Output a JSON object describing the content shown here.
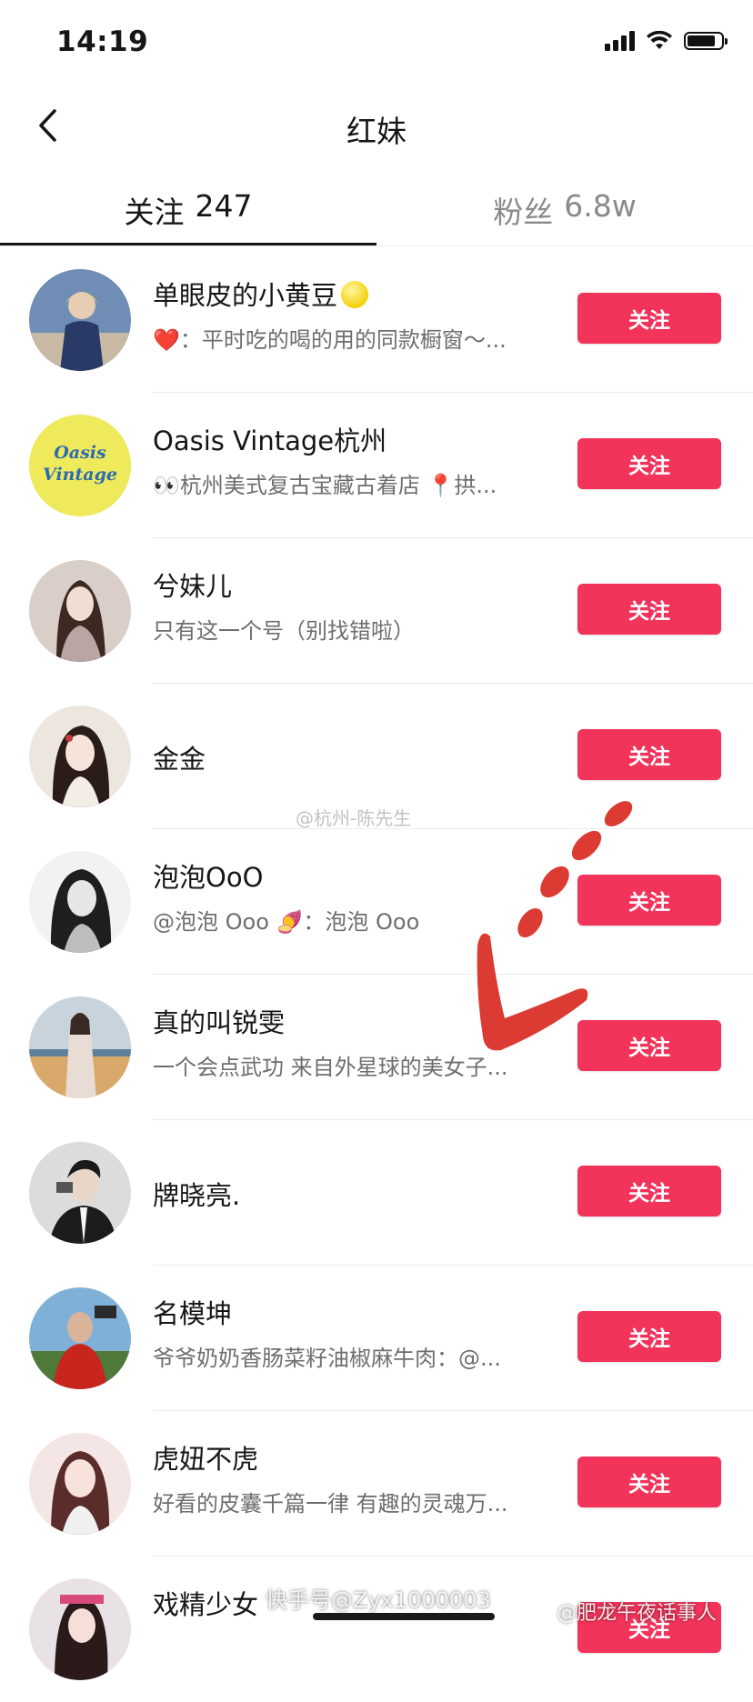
{
  "status_bar": {
    "time": "14:19"
  },
  "nav": {
    "title": "红妹"
  },
  "tabs": [
    {
      "label": "关注",
      "count": "247",
      "selected": true
    },
    {
      "label": "粉丝",
      "count": "6.8w",
      "selected": false
    }
  ],
  "users": [
    {
      "name": "单眼皮的小黄豆",
      "bio": "❤️：平时吃的喝的用的同款橱窗～...",
      "button": "关注"
    },
    {
      "name": "Oasis Vintage杭州",
      "bio": "👀杭州美式复古宝藏古着店 📍拱...",
      "button": "关注",
      "avatar_text": [
        "Oasis",
        "Vintage"
      ]
    },
    {
      "name": "兮妹儿",
      "bio": "只有这一个号（别找错啦）",
      "button": "关注"
    },
    {
      "name": "金金",
      "bio": "",
      "button": "关注"
    },
    {
      "name": "泡泡OoO",
      "bio": "@泡泡 Ooo 🍠：泡泡 Ooo",
      "button": "关注"
    },
    {
      "name": "真的叫锐雯",
      "bio": "一个会点武功 来自外星球的美女子...",
      "button": "关注"
    },
    {
      "name": "牌晓亮.",
      "bio": "",
      "button": "关注"
    },
    {
      "name": "名模坤",
      "bio": "爷爷奶奶香肠菜籽油椒麻牛肉：@...",
      "button": "关注"
    },
    {
      "name": "虎妞不虎",
      "bio": "好看的皮囊千篇一律 有趣的灵魂万...",
      "button": "关注"
    },
    {
      "name": "戏精少女",
      "bio": "",
      "button": "关注"
    }
  ],
  "watermarks": {
    "center": "@杭州-陈先生",
    "bottom_center": "快手号@Zyx1000003",
    "bottom_right": "@肥龙午夜话事人"
  },
  "colors": {
    "accent": "#f2335a",
    "text": "#161616",
    "muted": "#6e6e6e"
  }
}
